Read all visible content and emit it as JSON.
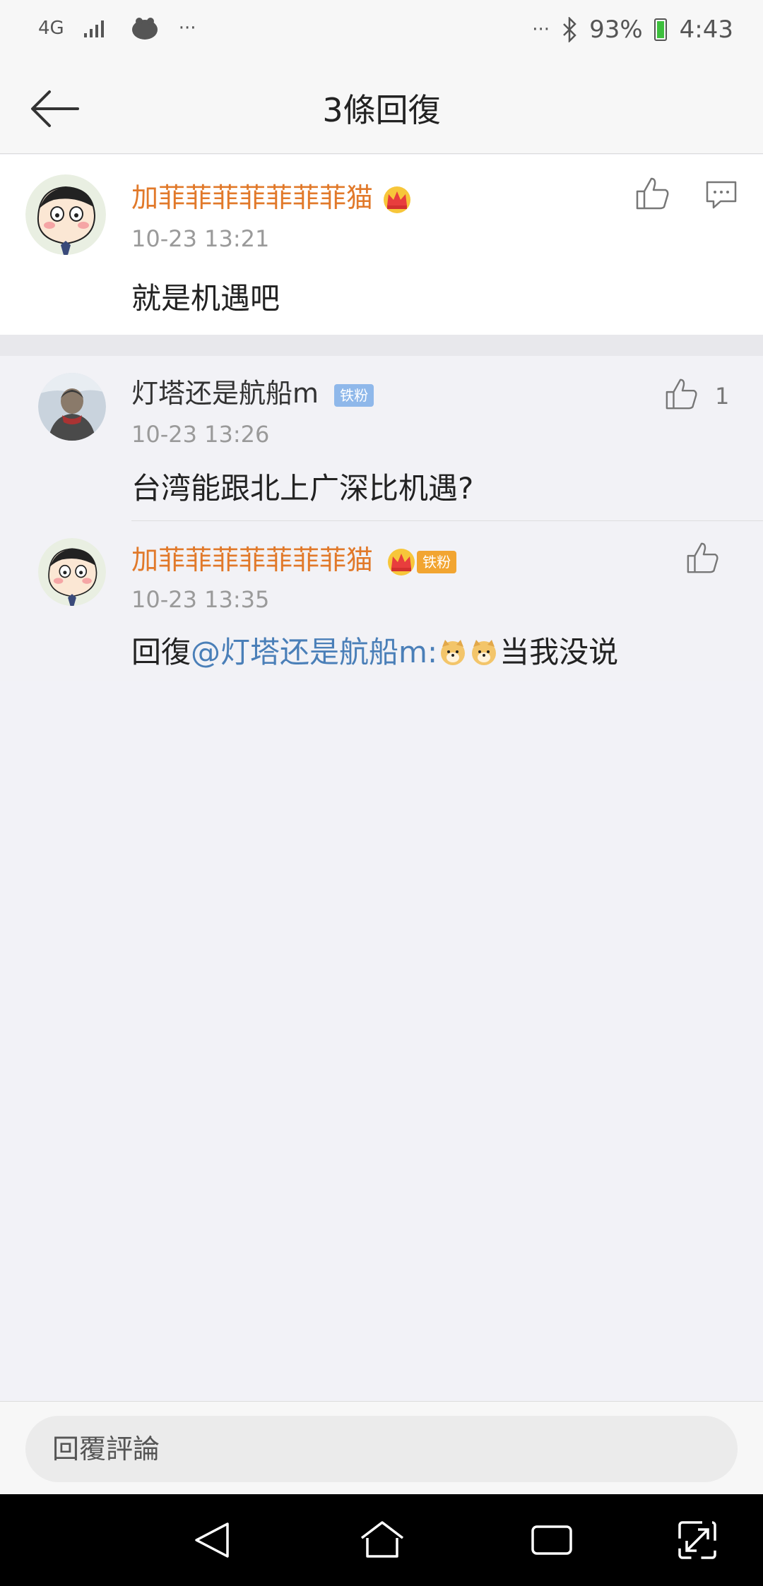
{
  "status_bar": {
    "network": "4G",
    "more_left": "···",
    "more_right": "···",
    "battery": "93%",
    "time": "4:43"
  },
  "header": {
    "title": "3條回復"
  },
  "main_comment": {
    "username": "加菲菲菲菲菲菲菲猫",
    "time": "10-23 13:21",
    "text": "就是机遇吧"
  },
  "replies": [
    {
      "username": "灯塔还是航船m",
      "badge": "铁粉",
      "time": "10-23 13:26",
      "text": "台湾能跟北上广深比机遇?",
      "like_count": "1"
    },
    {
      "username": "加菲菲菲菲菲菲菲猫",
      "badge": "铁粉",
      "time": "10-23 13:35",
      "reply_prefix": "回復",
      "mention": "@灯塔还是航船m",
      "colon": ":",
      "text_after": "当我没说"
    }
  ],
  "input": {
    "placeholder": "回覆評論"
  },
  "colors": {
    "vip_name": "#e1792a",
    "link": "#4a7fb8",
    "badge_blue": "#8fb8ea",
    "badge_orange": "#f2a531"
  }
}
